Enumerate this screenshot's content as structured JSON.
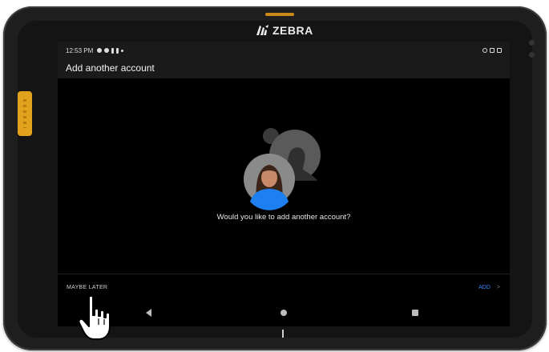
{
  "device": {
    "brand": "ZEBRA",
    "bumper_color": "#e3a21e"
  },
  "statusbar": {
    "time": "12:53 PM"
  },
  "appbar": {
    "title": "Add another account"
  },
  "main": {
    "prompt": "Would you like to add another account?"
  },
  "actions": {
    "later_label": "MAYBE LATER",
    "add_label": "ADD",
    "add_chevron": ">",
    "add_color": "#3b82f6"
  },
  "navbar": {
    "back_icon": "back-triangle-icon",
    "home_icon": "home-circle-icon",
    "recents_icon": "recents-square-icon"
  }
}
